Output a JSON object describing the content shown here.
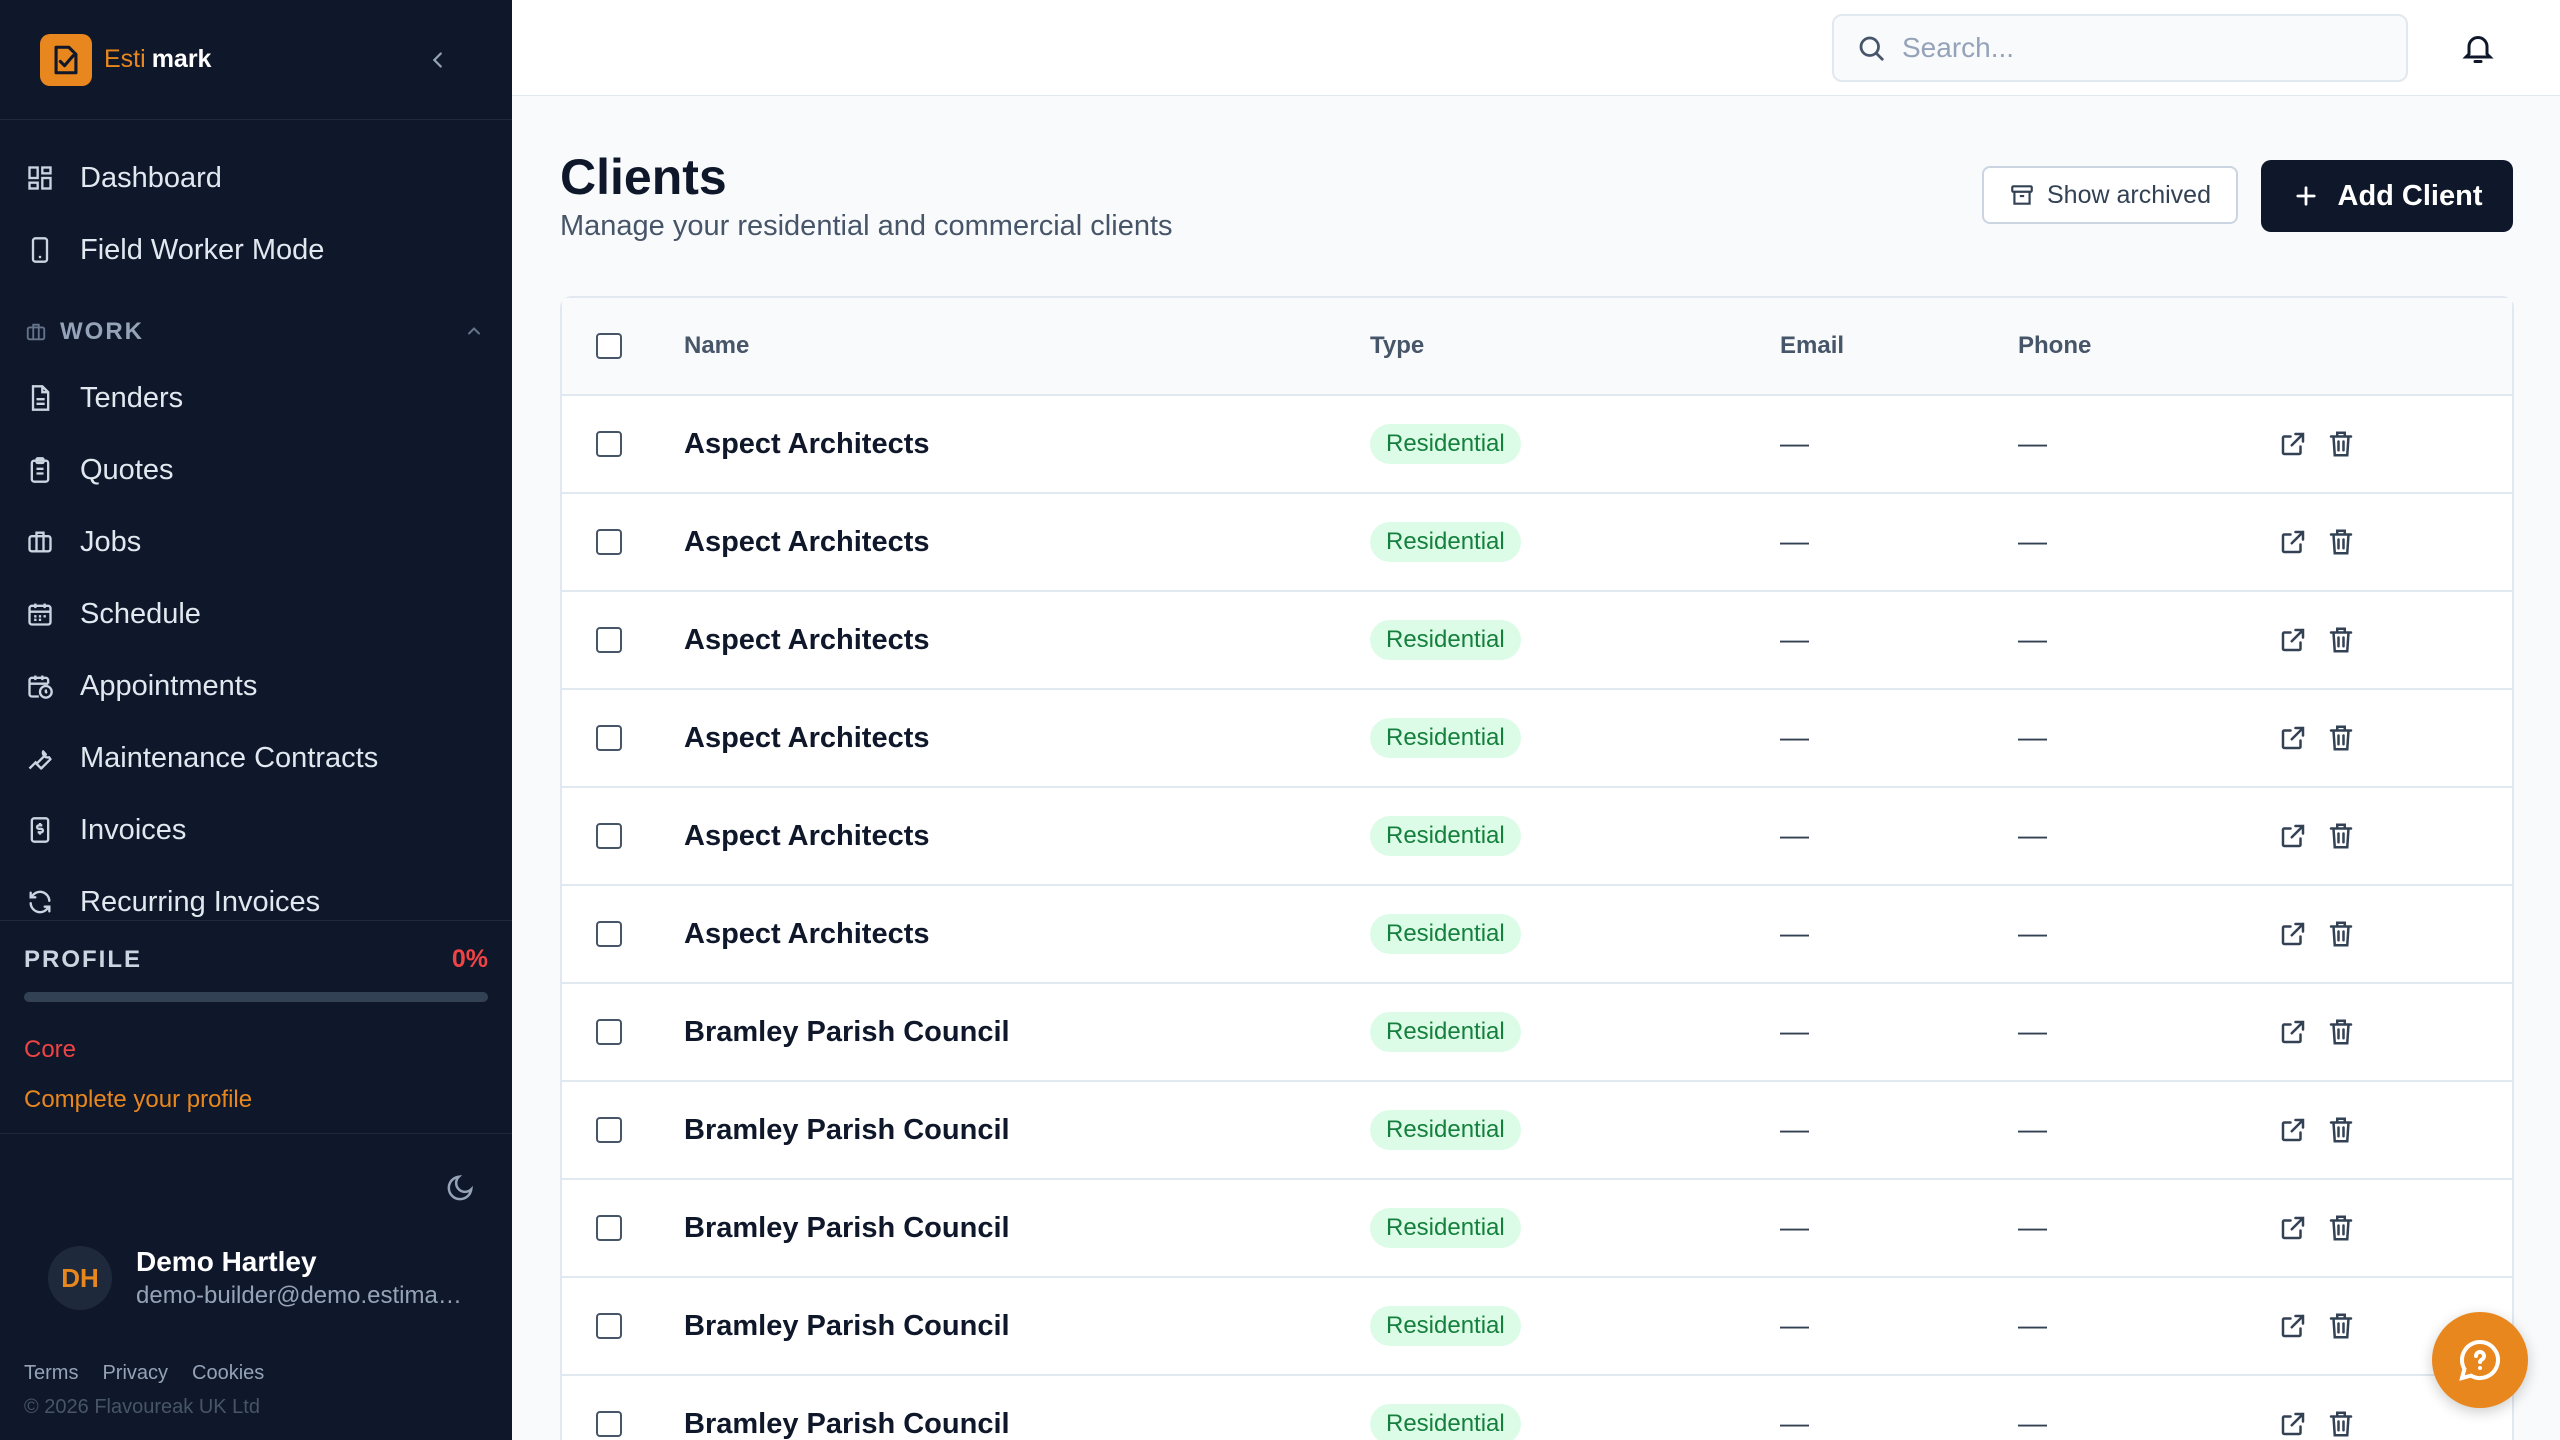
{
  "brand": {
    "part1": "Esti",
    "part2": "mark",
    "accent_color": "#e8871e"
  },
  "sidebar": {
    "top_items": [
      {
        "label": "Dashboard",
        "icon": "dashboard-icon"
      },
      {
        "label": "Field Worker Mode",
        "icon": "phone-icon"
      }
    ],
    "section": {
      "label": "WORK",
      "icon": "briefcase-icon"
    },
    "work_items": [
      {
        "label": "Tenders",
        "icon": "document-icon"
      },
      {
        "label": "Quotes",
        "icon": "clipboard-icon"
      },
      {
        "label": "Jobs",
        "icon": "briefcase-icon"
      },
      {
        "label": "Schedule",
        "icon": "calendar-icon"
      },
      {
        "label": "Appointments",
        "icon": "calendar-clock-icon"
      },
      {
        "label": "Maintenance Contracts",
        "icon": "wrench-icon"
      },
      {
        "label": "Invoices",
        "icon": "invoice-icon"
      },
      {
        "label": "Recurring Invoices",
        "icon": "refresh-icon"
      }
    ],
    "profile": {
      "title": "PROFILE",
      "percent_label": "0%",
      "percent": 0,
      "level": "Core",
      "link": "Complete your profile"
    },
    "user": {
      "initials": "DH",
      "name": "Demo Hartley",
      "email": "demo-builder@demo.estimark.co.uk"
    },
    "footer": {
      "terms": "Terms",
      "privacy": "Privacy",
      "cookies": "Cookies",
      "copyright": "© 2026 Flavoureak UK Ltd"
    }
  },
  "topbar": {
    "search_placeholder": "Search..."
  },
  "page": {
    "title": "Clients",
    "subtitle": "Manage your residential and commercial clients",
    "show_archived_label": "Show archived",
    "add_client_label": "Add Client"
  },
  "table": {
    "headers": {
      "name": "Name",
      "type": "Type",
      "email": "Email",
      "phone": "Phone"
    },
    "rows": [
      {
        "name": "Aspect Architects",
        "type": "Residential",
        "email": "—",
        "phone": "—"
      },
      {
        "name": "Aspect Architects",
        "type": "Residential",
        "email": "—",
        "phone": "—"
      },
      {
        "name": "Aspect Architects",
        "type": "Residential",
        "email": "—",
        "phone": "—"
      },
      {
        "name": "Aspect Architects",
        "type": "Residential",
        "email": "—",
        "phone": "—"
      },
      {
        "name": "Aspect Architects",
        "type": "Residential",
        "email": "—",
        "phone": "—"
      },
      {
        "name": "Aspect Architects",
        "type": "Residential",
        "email": "—",
        "phone": "—"
      },
      {
        "name": "Bramley Parish Council",
        "type": "Residential",
        "email": "—",
        "phone": "—"
      },
      {
        "name": "Bramley Parish Council",
        "type": "Residential",
        "email": "—",
        "phone": "—"
      },
      {
        "name": "Bramley Parish Council",
        "type": "Residential",
        "email": "—",
        "phone": "—"
      },
      {
        "name": "Bramley Parish Council",
        "type": "Residential",
        "email": "—",
        "phone": "—"
      },
      {
        "name": "Bramley Parish Council",
        "type": "Residential",
        "email": "—",
        "phone": "—"
      }
    ]
  }
}
